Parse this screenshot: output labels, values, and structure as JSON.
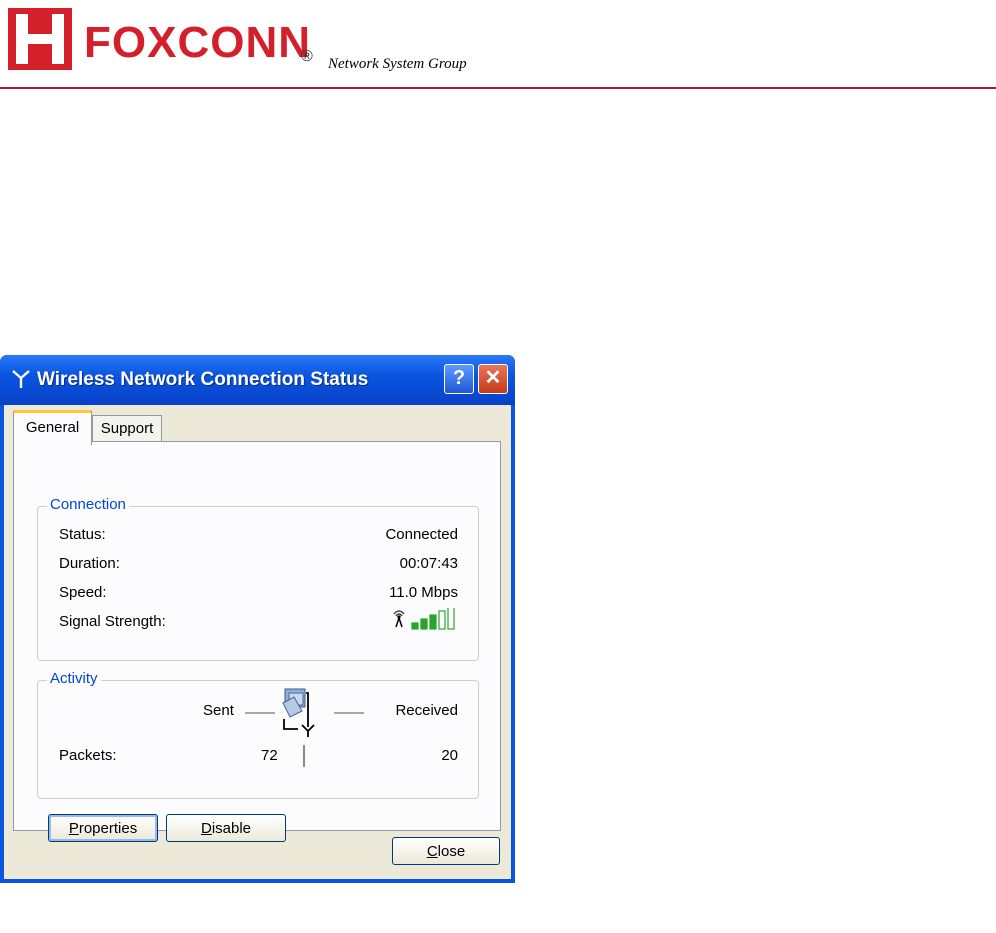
{
  "header": {
    "brand": "FOXCONN",
    "registered": "®",
    "tagline": "Network System Group"
  },
  "window": {
    "title": "Wireless Network Connection Status",
    "help_glyph": "?",
    "close_glyph": "✕",
    "tabs": [
      {
        "label": "General",
        "selected": true
      },
      {
        "label": "Support",
        "selected": false
      }
    ]
  },
  "connection": {
    "group_label": "Connection",
    "status_label": "Status:",
    "status_value": "Connected",
    "duration_label": "Duration:",
    "duration_value": "00:07:43",
    "speed_label": "Speed:",
    "speed_value": "11.0 Mbps",
    "signal_label": "Signal Strength:",
    "signal_bars_filled": 3,
    "signal_bars_total": 5,
    "signal_color": "#2aa52a"
  },
  "activity": {
    "group_label": "Activity",
    "sent_label": "Sent",
    "received_label": "Received",
    "packets_label": "Packets:",
    "packets_sent": "72",
    "packets_received": "20"
  },
  "buttons": {
    "properties_first": "P",
    "properties_rest": "roperties",
    "disable_first": "D",
    "disable_rest": "isable",
    "close_first": "C",
    "close_rest": "lose"
  },
  "colors": {
    "brand_red": "#d4202a",
    "titlebar_blue": "#0a56e0",
    "group_label_blue": "#0046d5",
    "dialog_bg": "#ece9d8"
  }
}
